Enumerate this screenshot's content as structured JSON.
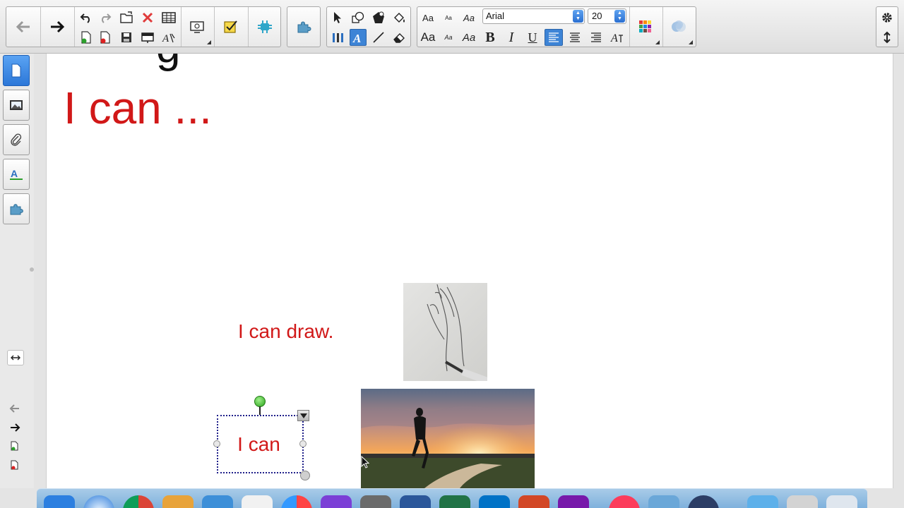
{
  "toolbar": {
    "font_family": "Arial",
    "font_size": "20",
    "text_style_labels": [
      "Aa",
      "Aa",
      "Aa",
      "Aa",
      "Aa",
      "Aa"
    ],
    "bold_label": "B",
    "italic_label": "I",
    "underline_label": "U"
  },
  "canvas": {
    "heading_fragment": "g",
    "title": "I can ...",
    "draw_caption": "I can draw.",
    "textbox_text": "I can"
  },
  "colors": {
    "red_text": "#d11818",
    "accent_blue": "#3d84d6"
  }
}
